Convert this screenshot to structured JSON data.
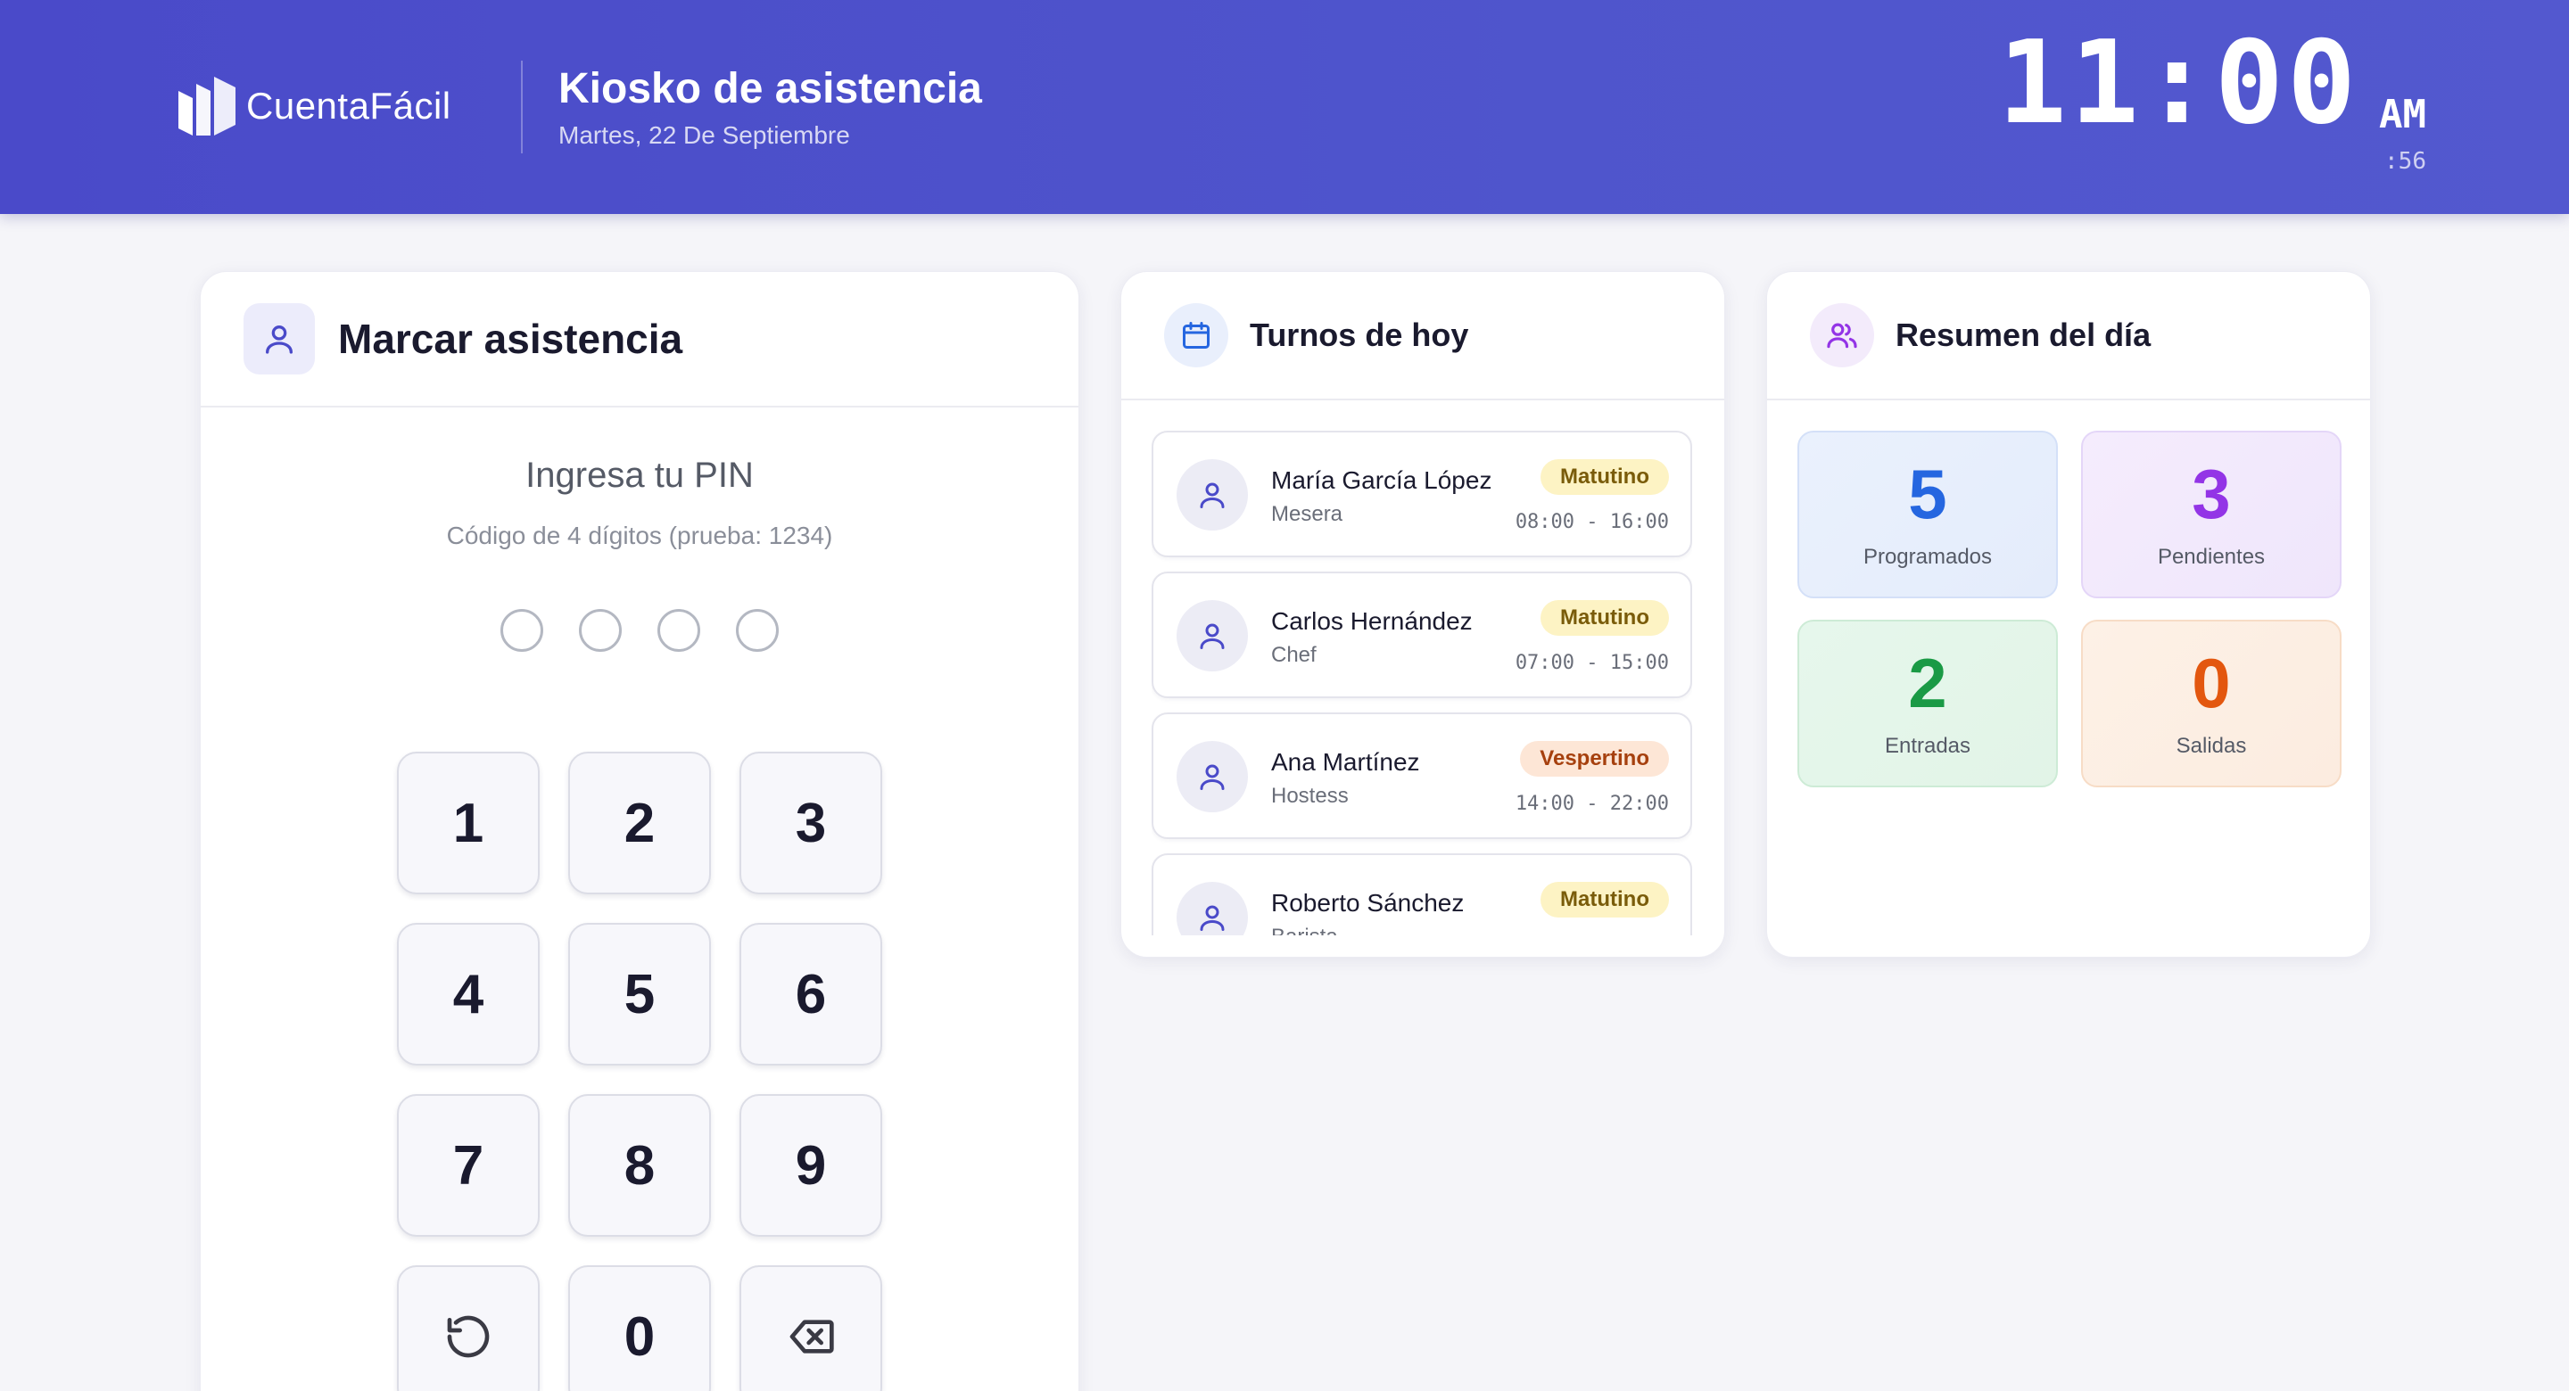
{
  "header": {
    "brand": "CuentaFácil",
    "title": "Kiosko de asistencia",
    "date": "Martes, 22 De Septiembre",
    "clock_time": "11:00",
    "clock_ampm": "AM",
    "clock_seconds": ":56"
  },
  "pin": {
    "card_title": "Marcar asistencia",
    "prompt": "Ingresa tu PIN",
    "hint": "Código de 4 dígitos (prueba: 1234)",
    "keys": [
      "1",
      "2",
      "3",
      "4",
      "5",
      "6",
      "7",
      "8",
      "9",
      "0"
    ]
  },
  "shifts": {
    "card_title": "Turnos de hoy",
    "items": [
      {
        "name": "María García López",
        "role": "Mesera",
        "shift": "Matutino",
        "hours": "08:00 - 16:00"
      },
      {
        "name": "Carlos Hernández",
        "role": "Chef",
        "shift": "Matutino",
        "hours": "07:00 - 15:00"
      },
      {
        "name": "Ana Martínez",
        "role": "Hostess",
        "shift": "Vespertino",
        "hours": "14:00 - 22:00"
      },
      {
        "name": "Roberto Sánchez",
        "role": "Barista",
        "shift": "Matutino",
        "hours": ""
      }
    ]
  },
  "summary": {
    "card_title": "Resumen del día",
    "programmed_value": "5",
    "programmed_label": "Programados",
    "pending_value": "3",
    "pending_label": "Pendientes",
    "entries_value": "2",
    "entries_label": "Entradas",
    "exits_value": "0",
    "exits_label": "Salidas"
  },
  "colors": {
    "header": "#4a4ac9",
    "blue": "#2566e0",
    "purple": "#9334e6",
    "green": "#1a9a45",
    "orange": "#e3570f"
  }
}
